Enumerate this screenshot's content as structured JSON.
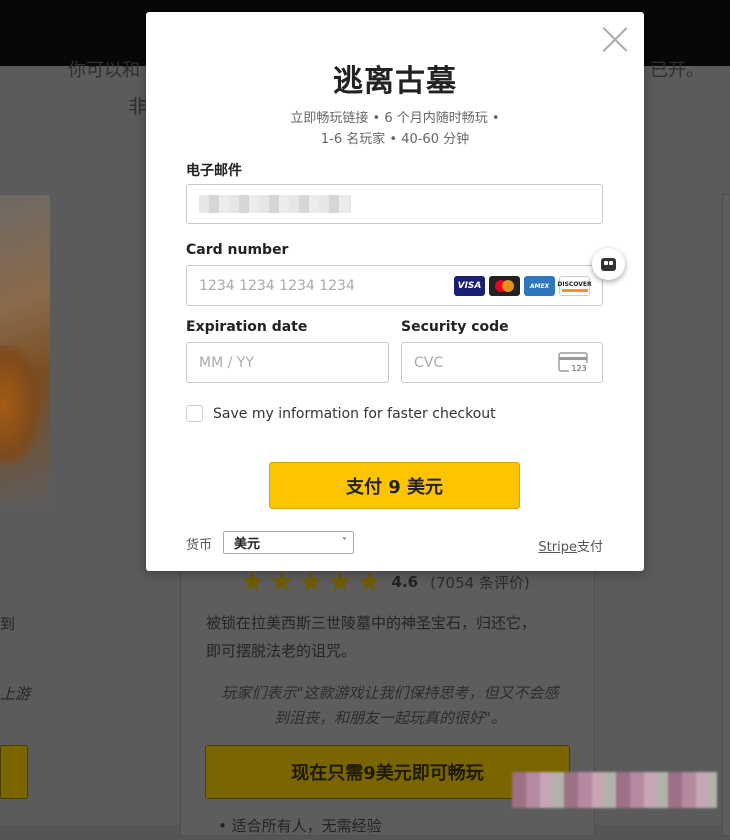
{
  "background": {
    "faint_line_1": "你可以和",
    "faint_line_1_right": "已开。",
    "faint_line_2": "非",
    "rating": "4.6",
    "reviews": "(7054 条评价)",
    "description_1": "被锁在拉美西斯三世陵墓中的神圣宝石，归还它，",
    "description_2": "即可摆脱法老的诅咒。",
    "quote_1": "玩家们表示\"这款游戏让我们保持思考，但又不会感",
    "quote_2": "到沮丧，和朋友一起玩真的很好\"。",
    "cta_button": "现在只需9美元即可畅玩",
    "left_text_1": "到",
    "left_text_2": "上游",
    "bullet": "•   适合所有人，无需经验"
  },
  "modal": {
    "title": "逃离古墓",
    "subtitle_line1": "立即畅玩链接 • 6 个月内随时畅玩 •",
    "subtitle_line2": "1-6 名玩家 • 40-60 分钟",
    "email_label": "电子邮件",
    "card_label": "Card number",
    "card_placeholder": "1234 1234 1234 1234",
    "card_brands": [
      "VISA",
      "MASTERCARD",
      "AMEX",
      "DISCOVER"
    ],
    "expiration_label": "Expiration date",
    "expiration_placeholder": "MM / YY",
    "security_label": "Security code",
    "security_placeholder": "CVC",
    "cvc_hint": "123",
    "save_info_label": "Save my information for faster checkout",
    "pay_button": "支付 9 美元",
    "currency_label": "货币",
    "currency_value": "美元",
    "stripe_link": "Stripe",
    "stripe_suffix": "支付"
  },
  "icons": {
    "close": "close-icon",
    "bot": "chat-bot-icon",
    "cvc": "credit-card-cvc-icon"
  },
  "colors": {
    "pay_button": "#ffc400",
    "overlay": "#5b5b5b"
  }
}
